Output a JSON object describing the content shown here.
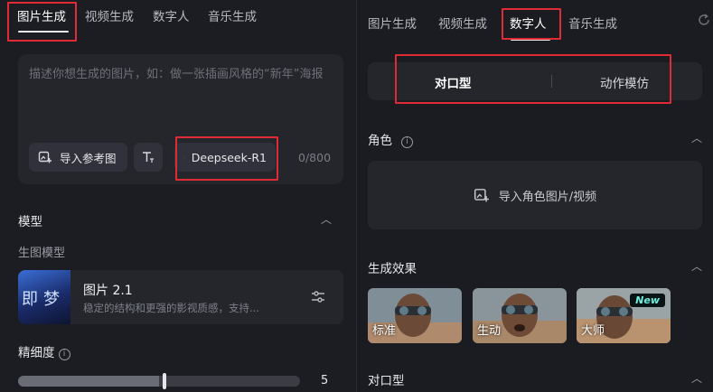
{
  "left": {
    "tabs": [
      "图片生成",
      "视频生成",
      "数字人",
      "音乐生成"
    ],
    "prompt": {
      "placeholder": "描述你想生成的图片，如：做一张插画风格的“新年”海报",
      "import_ref_label": "导入参考图",
      "text_tool_icon": "text-style-icon",
      "model_button_label": "Deepseek-R1",
      "char_count": "0/800"
    },
    "model_section": {
      "title": "模型",
      "subtitle": "生图模型",
      "model_name": "图片 2.1",
      "model_desc": "稳定的结构和更强的影视质感，支持...",
      "thumb_text": "即梦"
    },
    "detail": {
      "title": "精细度",
      "value": 5,
      "fraction": 0.5
    }
  },
  "right": {
    "tabs": [
      "图片生成",
      "视频生成",
      "数字人",
      "音乐生成"
    ],
    "modes": [
      "对口型",
      "动作模仿"
    ],
    "role": {
      "title": "角色",
      "upload_label": "导入角色图片/视频"
    },
    "effects": {
      "title": "生成效果",
      "items": [
        "标准",
        "生动",
        "大师"
      ],
      "badge": "New"
    },
    "lip_sync": {
      "title": "对口型"
    }
  },
  "colors": {
    "background": "#17181d",
    "panel": "#1c1d22",
    "card": "#25262c",
    "highlight_box": "#e02a35",
    "badge_text": "#6df0e0"
  }
}
